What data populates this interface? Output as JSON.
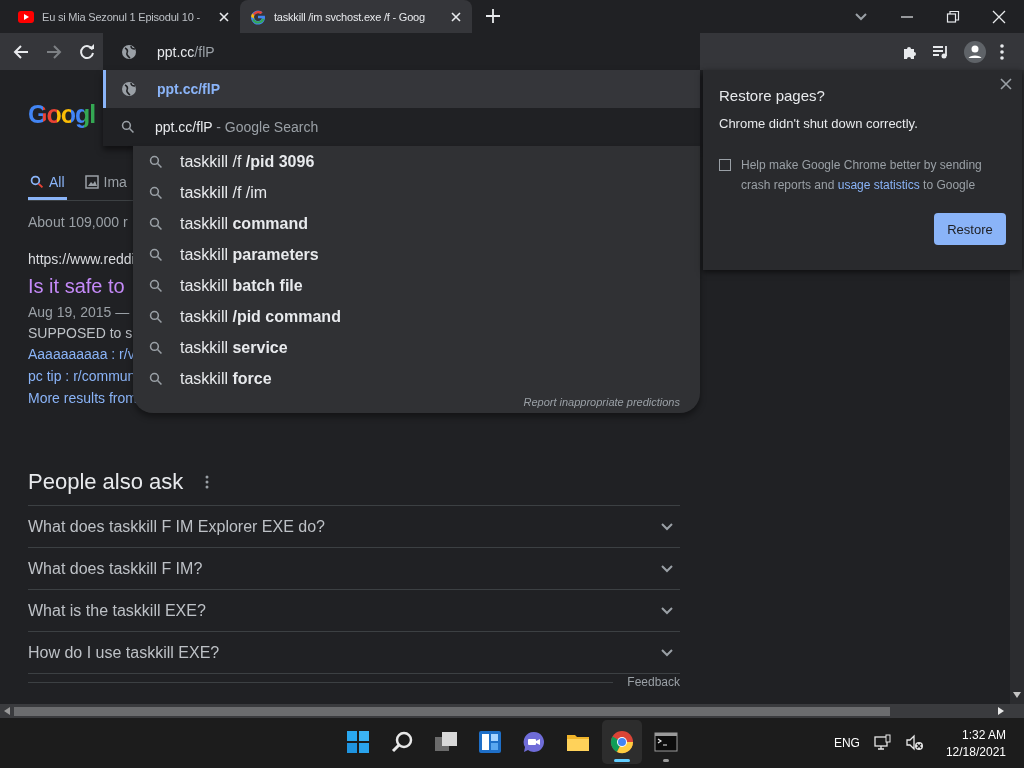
{
  "browser_tabs": [
    {
      "title": "Eu si Mia Sezonul 1 Episodul 10 -",
      "kind": "video",
      "selected": false
    },
    {
      "title": "taskkill /im svchost.exe /f - Goog",
      "kind": "google",
      "selected": true
    }
  ],
  "omnibox": {
    "typed": "ppt.cc",
    "completion": "/flP"
  },
  "omnibox_suggestions": [
    {
      "kind": "url",
      "text": "ppt.cc/flP",
      "selected": true
    },
    {
      "kind": "search",
      "text": "ppt.cc/flP",
      "suffix": "- Google Search",
      "selected": false
    }
  ],
  "page": {
    "logo": "Googl",
    "search_tabs": [
      {
        "kind": "search",
        "label": "All",
        "selected": true
      },
      {
        "kind": "image",
        "label": "Ima",
        "selected": false
      }
    ],
    "result_stats": "About 109,000 r",
    "result": {
      "url": "https://www.reddi",
      "title": "Is it safe to",
      "date": "Aug 19, 2015 —",
      "snippet": "SUPPOSED to s",
      "sitelinks": [
        "Aaaaaaaaaa : r/v",
        "pc tip : r/commun"
      ],
      "more": "More results from"
    },
    "people_also_ask": {
      "heading": "People also ask",
      "questions": [
        {
          "text": "What does taskkill F IM Explorer EXE do?",
          "expanded": false
        },
        {
          "text": "What does taskkill F IM?",
          "expanded": false
        },
        {
          "text": "What is the taskkill EXE?",
          "expanded": false
        },
        {
          "text": "How do I use taskkill EXE?",
          "expanded": false
        }
      ],
      "feedback": "Feedback"
    }
  },
  "search_suggestions": {
    "items": [
      "taskkill /f **/pid 3096**",
      "taskkill /f /im",
      "taskkill **command**",
      "taskkill **parameters**",
      "taskkill **batch file**",
      "taskkill **/pid command**",
      "taskkill **service**",
      "taskkill **force**"
    ],
    "report": "Report inappropriate predictions"
  },
  "restore_dialog": {
    "title": "Restore pages?",
    "message": "Chrome didn't shut down correctly.",
    "checkbox": {
      "checked": false,
      "text_before": "Help make Google Chrome better by sending crash reports and",
      "link": "usage statistics",
      "text_after": "to Google"
    },
    "button": "Restore"
  },
  "taskbar": {
    "apps": [
      {
        "kind": "start",
        "open": false,
        "active": false
      },
      {
        "kind": "search",
        "open": false,
        "active": false
      },
      {
        "kind": "taskview",
        "open": false,
        "active": false
      },
      {
        "kind": "widgets",
        "open": false,
        "active": false
      },
      {
        "kind": "chat",
        "open": false,
        "active": false
      },
      {
        "kind": "explorer",
        "open": false,
        "active": false
      },
      {
        "kind": "chrome",
        "open": true,
        "active": true
      },
      {
        "kind": "terminal",
        "open": true,
        "active": false
      }
    ],
    "language": "ENG",
    "time": "1:32 AM",
    "date": "12/18/2021"
  }
}
